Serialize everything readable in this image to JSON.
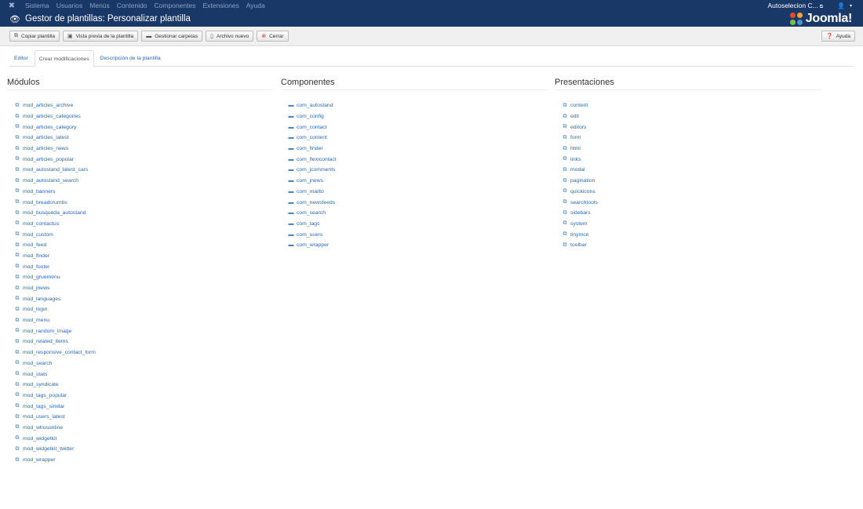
{
  "topnav": {
    "menu": [
      "Sistema",
      "Usuarios",
      "Menús",
      "Contenido",
      "Componentes",
      "Extensiones",
      "Ayuda"
    ],
    "site_name": "Autoselecion C..."
  },
  "header": {
    "title": "Gestor de plantillas: Personalizar plantilla",
    "logo_text": "Joomla!"
  },
  "toolbar": {
    "buttons": [
      {
        "label": "Copiar plantilla",
        "icon": "copy-icon"
      },
      {
        "label": "Vista previa de la plantilla",
        "icon": "picture-icon"
      },
      {
        "label": "Gestionar carpetas",
        "icon": "folder-icon"
      },
      {
        "label": "Archivo nuevo",
        "icon": "file-icon"
      },
      {
        "label": "Cerrar",
        "icon": "cancel-icon"
      }
    ],
    "help": "Ayuda"
  },
  "tabs": [
    "Editor",
    "Crear modificaciones",
    "Descripción de la plantilla"
  ],
  "active_tab": 1,
  "columns": {
    "modules": {
      "title": "Módulos",
      "items": [
        "mod_articles_archive",
        "mod_articles_categories",
        "mod_articles_category",
        "mod_articles_latest",
        "mod_articles_news",
        "mod_articles_popular",
        "mod_autostand_latest_cars",
        "mod_autostand_search",
        "mod_banners",
        "mod_breadcrumbs",
        "mod_busqueda_autostand",
        "mod_contactus",
        "mod_custom",
        "mod_feed",
        "mod_finder",
        "mod_footer",
        "mod_gruemenu",
        "mod_jnews",
        "mod_languages",
        "mod_login",
        "mod_menu",
        "mod_random_image",
        "mod_related_items",
        "mod_responsive_contact_form",
        "mod_search",
        "mod_stats",
        "mod_syndicate",
        "mod_tags_popular",
        "mod_tags_similar",
        "mod_users_latest",
        "mod_whosonline",
        "mod_widgetkit",
        "mod_widgetkit_twitter",
        "mod_wrapper"
      ]
    },
    "components": {
      "title": "Componentes",
      "items": [
        "com_autostand",
        "com_config",
        "com_contact",
        "com_content",
        "com_finder",
        "com_flexicontact",
        "com_jcomments",
        "com_jnews",
        "com_mailto",
        "com_newsfeeds",
        "com_search",
        "com_tags",
        "com_users",
        "com_wrapper"
      ]
    },
    "layouts": {
      "title": "Presentaciones",
      "items": [
        "content",
        "edit",
        "editors",
        "form",
        "html",
        "links",
        "modal",
        "pagination",
        "quickicons",
        "searchtools",
        "sidebars",
        "system",
        "tinymce",
        "toolbar"
      ]
    }
  }
}
